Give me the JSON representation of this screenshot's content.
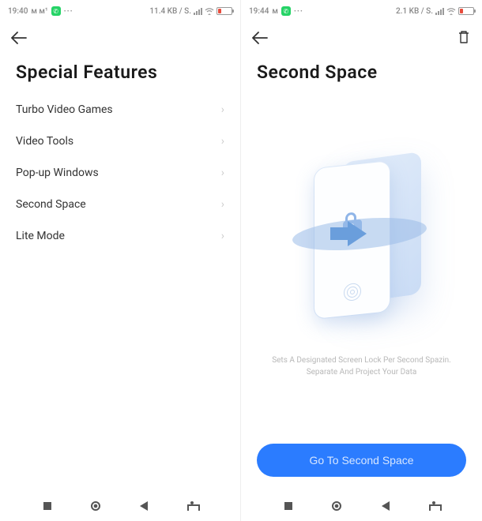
{
  "left": {
    "status": {
      "time": "19:40",
      "sub": "м м¹",
      "speed": "11.4 KB / S."
    },
    "title": "Special Features",
    "items": [
      {
        "label": "Turbo Video Games"
      },
      {
        "label": "Video Tools"
      },
      {
        "label": "Pop-up Windows"
      },
      {
        "label": "Second Space"
      },
      {
        "label": "Lite Mode"
      }
    ]
  },
  "right": {
    "status": {
      "time": "19:44",
      "sub": "м",
      "speed": "2.1 KB / S."
    },
    "title": "Second Space",
    "caption_line1": "Sets A Designated Screen Lock Per Second Spazin.",
    "caption_line2": "Separate And Project Your Data",
    "cta": "Go To Second Space"
  }
}
